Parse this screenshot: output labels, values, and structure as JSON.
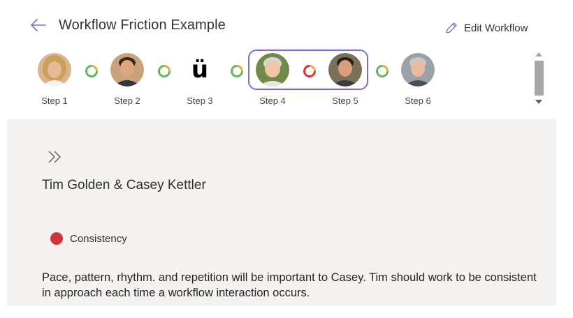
{
  "header": {
    "title": "Workflow Friction Example",
    "edit_label": "Edit Workflow"
  },
  "steps": [
    {
      "label": "Step 1",
      "avatar": "woman-blonde-photo",
      "bg": "#d9b48f",
      "skin": "#e8b997",
      "hair": "#c9a05a"
    },
    {
      "label": "Step 2",
      "avatar": "man-dark-hair-photo",
      "bg": "#c7a27a",
      "skin": "#e0a47e",
      "hair": "#3a2a1f"
    },
    {
      "label": "Step 3",
      "avatar_glyph": "ü"
    },
    {
      "label": "Step 4",
      "avatar": "man-gray-hair-outdoor-photo",
      "bg": "#6f8a4a",
      "skin": "#f0c6a4",
      "hair": "#d8d5cc"
    },
    {
      "label": "Step 5",
      "avatar": "man-dark-hair-photo",
      "bg": "#7b6f5a",
      "skin": "#d7a07a",
      "hair": "#2b211b"
    },
    {
      "label": "Step 6",
      "avatar": "man-gray-hair-photo",
      "bg": "#9aa1a8",
      "skin": "#e7bca0",
      "hair": "#c8c8c8"
    }
  ],
  "connectors": [
    {
      "between": "1-2",
      "colors": [
        "#e8b340",
        "#5fb85a"
      ]
    },
    {
      "between": "2-3",
      "colors": [
        "#e8b340",
        "#5fb85a"
      ]
    },
    {
      "between": "3-4",
      "colors": [
        "#e8b340",
        "#5fb85a"
      ]
    },
    {
      "between": "4-5",
      "colors": [
        "#d13438",
        "#e8b340"
      ]
    },
    {
      "between": "5-6",
      "colors": [
        "#e8b340",
        "#5fb85a"
      ]
    }
  ],
  "icons": {
    "back": "arrow-left-icon",
    "edit": "pencil-icon",
    "expand": "double-chevron-right-icon"
  },
  "detail": {
    "names": "Tim Golden & Casey Kettler",
    "badge_label": "Consistency",
    "badge_color": "#d13438",
    "description": "Pace, pattern, rhythm. and repetition will be important to Casey. Tim should work to be consistent in approach each time a workflow interaction occurs."
  },
  "accent_color": "#7b6fd6"
}
